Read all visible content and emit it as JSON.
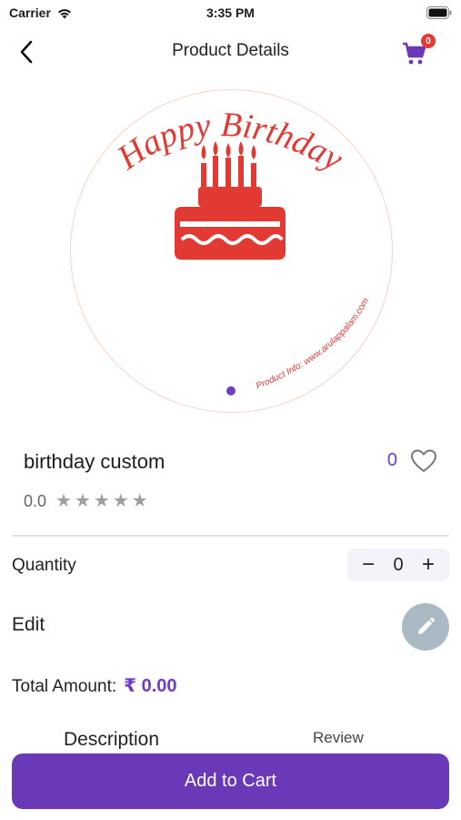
{
  "status_bar": {
    "carrier": "Carrier",
    "time": "3:35 PM"
  },
  "nav": {
    "title": "Product Details",
    "cart_count": "0"
  },
  "image": {
    "headline": "Happy Birthday",
    "footer": "Product Info: www.arulappalam.com",
    "page_count": 1
  },
  "product": {
    "name": "birthday custom",
    "likes": "0",
    "rating": "0.0",
    "stars": 5
  },
  "quantity": {
    "label": "Quantity",
    "minus": "−",
    "value": "0",
    "plus": "+"
  },
  "edit": {
    "label": "Edit"
  },
  "total": {
    "label": "Total Amount:",
    "amount": "₹ 0.00"
  },
  "tabs": {
    "description": "Description",
    "review": "Review"
  },
  "cta": {
    "label": "Add to Cart"
  },
  "colors": {
    "accent": "#6a39b8",
    "cake": "#e23a33",
    "badge": "#e53935"
  }
}
